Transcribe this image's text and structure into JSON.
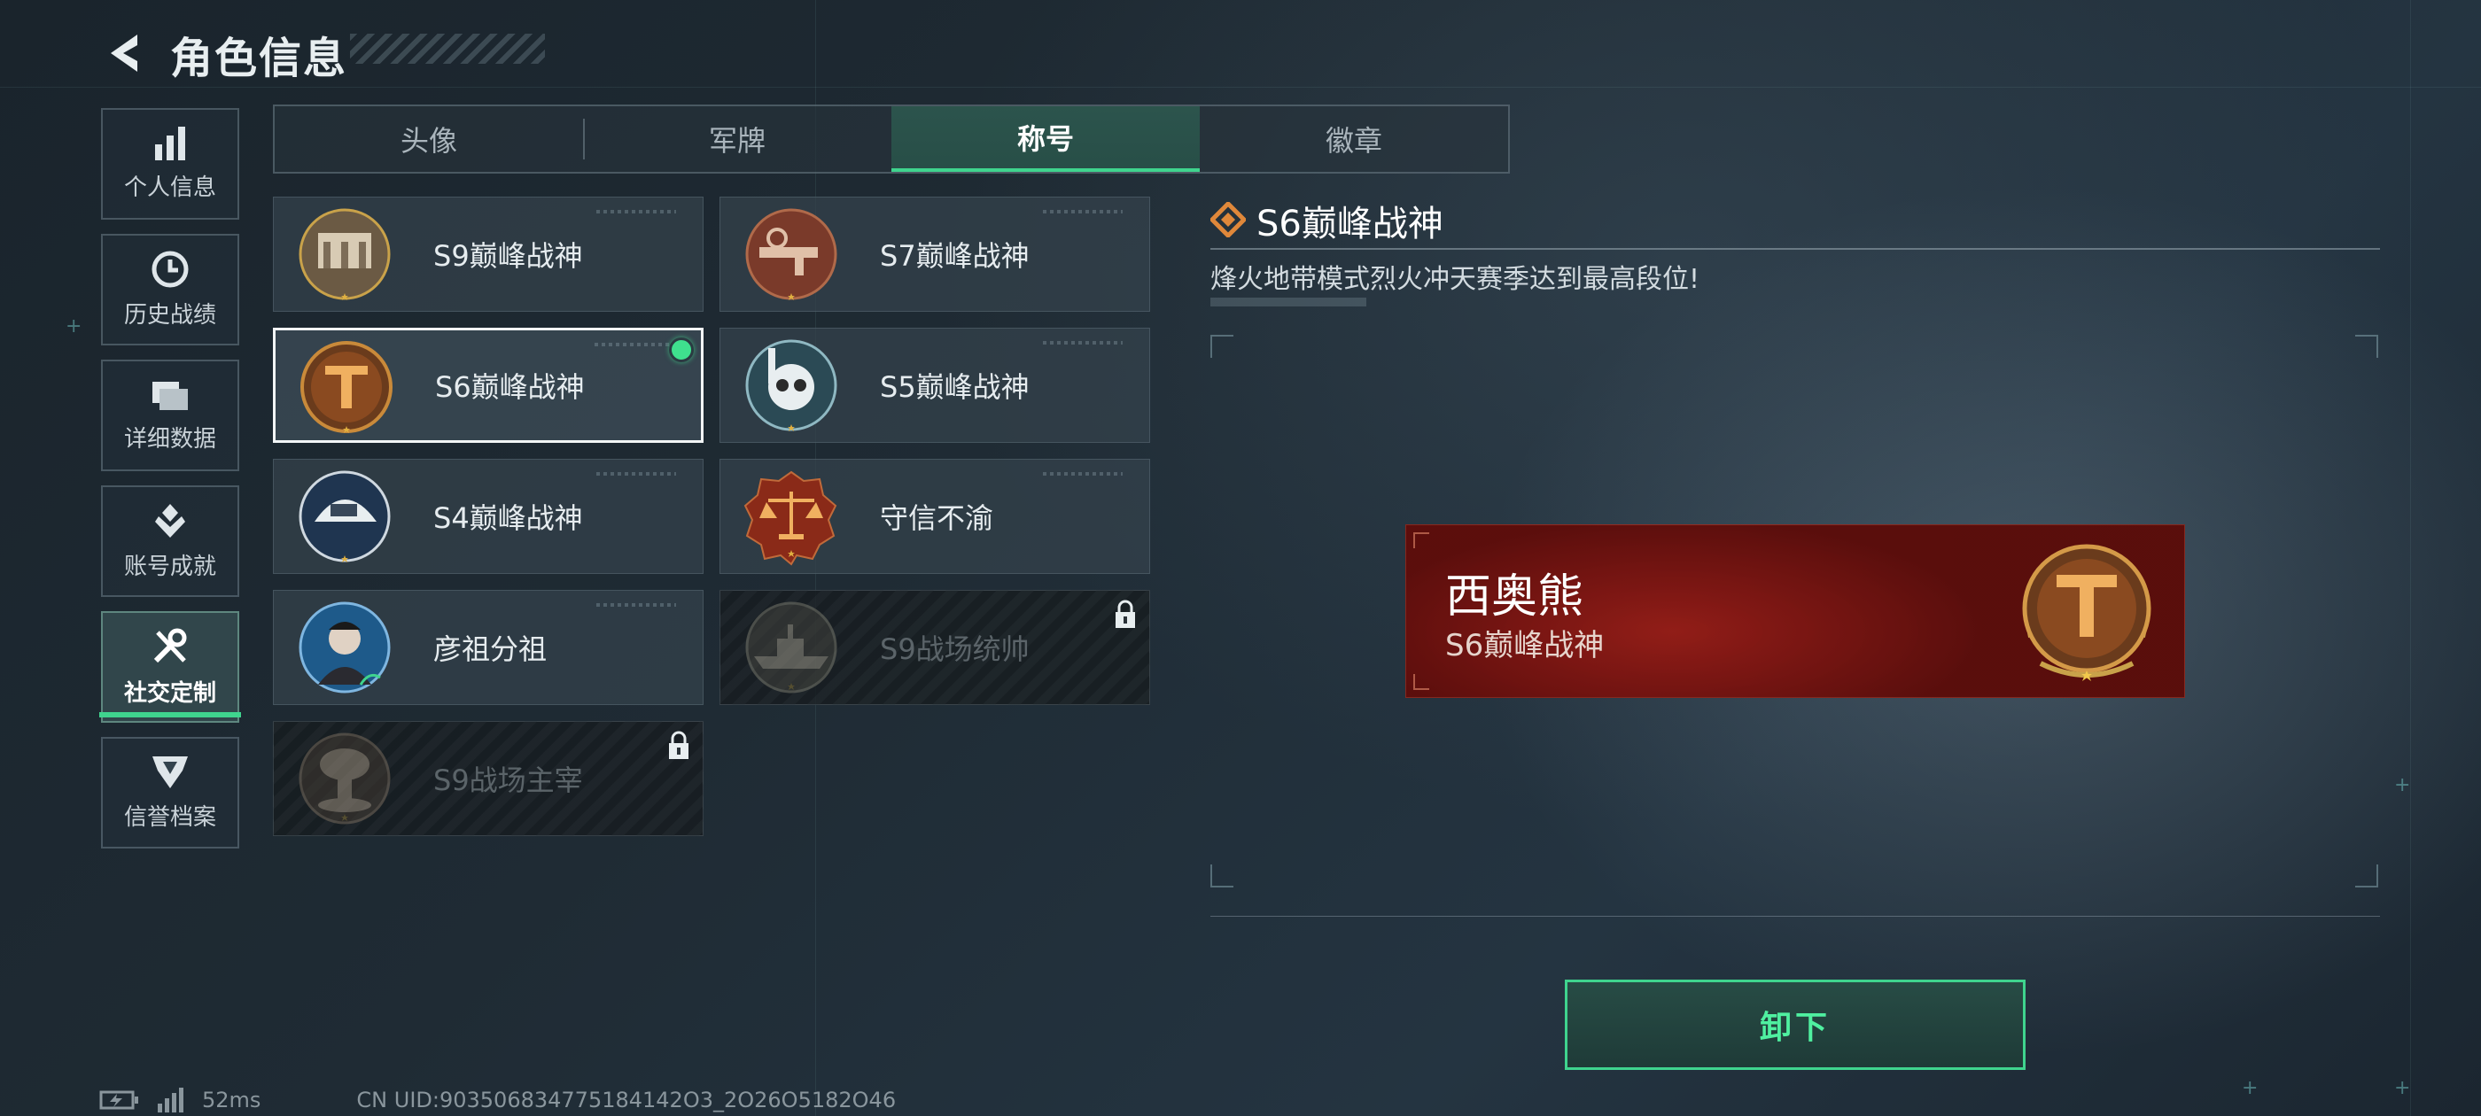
{
  "header": {
    "title": "角色信息"
  },
  "sidebar": {
    "items": [
      {
        "label": "个人信息",
        "icon": "bar-chart-icon",
        "active": false
      },
      {
        "label": "历史战绩",
        "icon": "clock-icon",
        "active": false
      },
      {
        "label": "详细数据",
        "icon": "folder-icon",
        "active": false
      },
      {
        "label": "账号成就",
        "icon": "achievement-icon",
        "active": false
      },
      {
        "label": "社交定制",
        "icon": "tools-icon",
        "active": true
      },
      {
        "label": "信誉档案",
        "icon": "reputation-shield-icon",
        "active": false
      }
    ]
  },
  "tabs": [
    {
      "label": "头像",
      "active": false
    },
    {
      "label": "军牌",
      "active": false
    },
    {
      "label": "称号",
      "active": true
    },
    {
      "label": "徽章",
      "active": false
    }
  ],
  "titles": [
    {
      "label": "S9巅峰战神",
      "medal": "fortress-medal-icon",
      "state": "normal"
    },
    {
      "label": "S7巅峰战神",
      "medal": "rifle-medal-icon",
      "state": "normal"
    },
    {
      "label": "S6巅峰战神",
      "medal": "t-emblem-medal-icon",
      "state": "selected-equipped"
    },
    {
      "label": "S5巅峰战神",
      "medal": "skull-diver-medal-icon",
      "state": "normal"
    },
    {
      "label": "S4巅峰战神",
      "medal": "helmet-medal-icon",
      "state": "normal"
    },
    {
      "label": "守信不渝",
      "medal": "scales-medal-icon",
      "state": "normal"
    },
    {
      "label": "彦祖分祖",
      "medal": "portrait-medal-icon",
      "state": "normal"
    },
    {
      "label": "S9战场统帅",
      "medal": "warship-medal-icon",
      "state": "locked"
    },
    {
      "label": "S9战场主宰",
      "medal": "mushroom-cloud-medal-icon",
      "state": "locked"
    }
  ],
  "detail": {
    "title": "S6巅峰战神",
    "description": "烽火地带模式烈火冲天赛季达到最高段位!"
  },
  "nameplate": {
    "player_name": "西奥熊",
    "title": "S6巅峰战神"
  },
  "action": {
    "label": "卸下"
  },
  "footer": {
    "ping": "52ms",
    "uid": "CN UID:903506834775184142O3_2O26O5182O46"
  },
  "colors": {
    "accent": "#3fd48e",
    "equipped": "#3fe08e",
    "nameplate_red": "#7a1512",
    "gold": "#c9a24a"
  }
}
